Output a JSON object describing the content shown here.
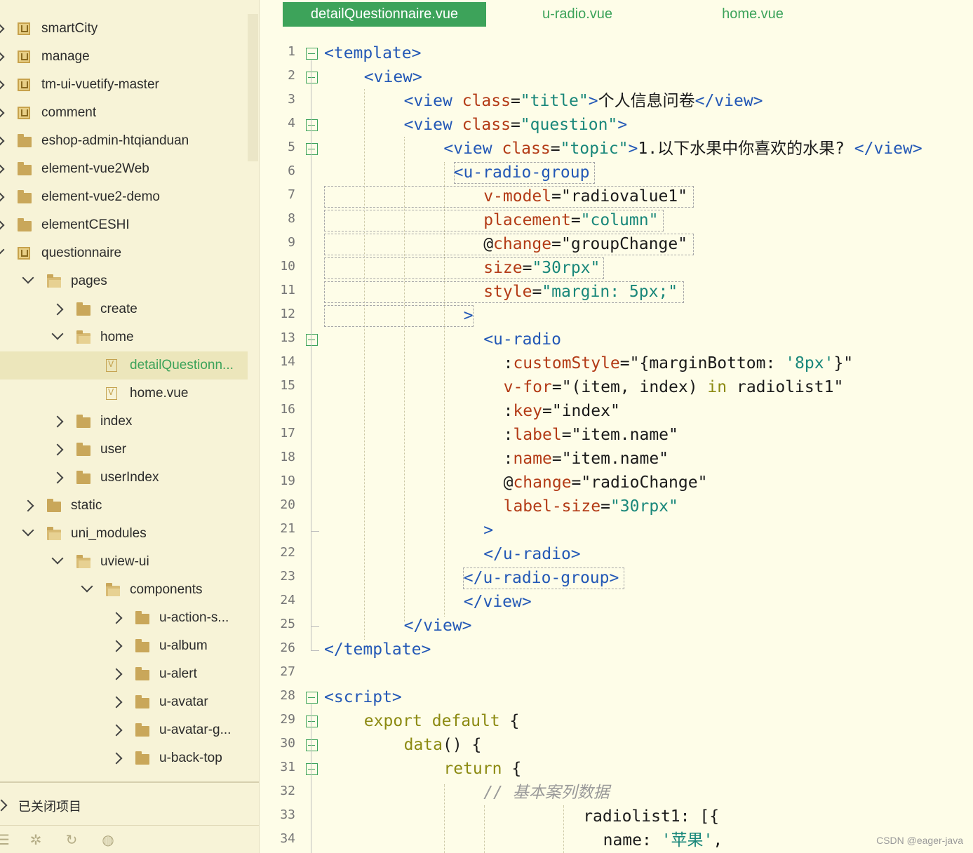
{
  "sidebar": {
    "tree": [
      {
        "label": "smartCity",
        "type": "project",
        "expanded": false,
        "depth": 0
      },
      {
        "label": "manage",
        "type": "project",
        "expanded": false,
        "depth": 0
      },
      {
        "label": "tm-ui-vuetify-master",
        "type": "project",
        "expanded": false,
        "depth": 0
      },
      {
        "label": "comment",
        "type": "project",
        "expanded": false,
        "depth": 0
      },
      {
        "label": "eshop-admin-htqianduan",
        "type": "folder-project",
        "expanded": false,
        "depth": 0
      },
      {
        "label": "element-vue2Web",
        "type": "folder-project",
        "expanded": false,
        "depth": 0
      },
      {
        "label": "element-vue2-demo",
        "type": "folder-project",
        "expanded": false,
        "depth": 0
      },
      {
        "label": "elementCESHI",
        "type": "folder-project",
        "expanded": false,
        "depth": 0
      },
      {
        "label": "questionnaire",
        "type": "project",
        "expanded": true,
        "depth": 0
      },
      {
        "label": "pages",
        "type": "folder",
        "expanded": true,
        "depth": 1
      },
      {
        "label": "create",
        "type": "folder",
        "expanded": false,
        "depth": 2
      },
      {
        "label": "home",
        "type": "folder",
        "expanded": true,
        "depth": 2
      },
      {
        "label": "detailQuestionn...",
        "type": "vue-file",
        "selected": true,
        "depth": 3
      },
      {
        "label": "home.vue",
        "type": "vue-file",
        "depth": 3
      },
      {
        "label": "index",
        "type": "folder",
        "expanded": false,
        "depth": 2
      },
      {
        "label": "user",
        "type": "folder",
        "expanded": false,
        "depth": 2
      },
      {
        "label": "userIndex",
        "type": "folder",
        "expanded": false,
        "depth": 2
      },
      {
        "label": "static",
        "type": "folder",
        "expanded": false,
        "depth": 1
      },
      {
        "label": "uni_modules",
        "type": "folder",
        "expanded": true,
        "depth": 1
      },
      {
        "label": "uview-ui",
        "type": "folder",
        "expanded": true,
        "depth": 2
      },
      {
        "label": "components",
        "type": "folder",
        "expanded": true,
        "depth": 3
      },
      {
        "label": "u-action-s...",
        "type": "folder",
        "expanded": false,
        "depth": 4
      },
      {
        "label": "u-album",
        "type": "folder",
        "expanded": false,
        "depth": 4
      },
      {
        "label": "u-alert",
        "type": "folder",
        "expanded": false,
        "depth": 4
      },
      {
        "label": "u-avatar",
        "type": "folder",
        "expanded": false,
        "depth": 4
      },
      {
        "label": "u-avatar-g...",
        "type": "folder",
        "expanded": false,
        "depth": 4
      },
      {
        "label": "u-back-top",
        "type": "folder",
        "expanded": false,
        "depth": 4
      }
    ],
    "closed_projects_label": "已关闭项目",
    "bottom_icons": [
      "list-icon",
      "bug-icon",
      "sync-icon",
      "globe-icon"
    ]
  },
  "tabs": [
    {
      "label": "detailQuestionnaire.vue",
      "active": true
    },
    {
      "label": "u-radio.vue",
      "active": false
    },
    {
      "label": "home.vue",
      "active": false
    }
  ],
  "code": [
    {
      "n": "1",
      "fold": "open",
      "tokens": [
        [
          "tag",
          "<template>"
        ]
      ]
    },
    {
      "n": "2",
      "fold": "open",
      "tokens": [
        [
          "tag",
          "<view>"
        ]
      ]
    },
    {
      "n": "3",
      "tokens": [
        [
          "tag",
          "<view "
        ],
        [
          "attr",
          "class"
        ],
        [
          "punc",
          "="
        ],
        [
          "str",
          "\"title\""
        ],
        [
          "tag",
          ">"
        ],
        [
          "plain",
          "个人信息问卷"
        ],
        [
          "tag",
          "</view>"
        ]
      ]
    },
    {
      "n": "4",
      "fold": "open",
      "tokens": [
        [
          "tag",
          "<view "
        ],
        [
          "attr",
          "class"
        ],
        [
          "punc",
          "="
        ],
        [
          "str",
          "\"question\""
        ],
        [
          "tag",
          ">"
        ]
      ]
    },
    {
      "n": "5",
      "fold": "open",
      "tokens": [
        [
          "tag",
          "<view "
        ],
        [
          "attr",
          "class"
        ],
        [
          "punc",
          "="
        ],
        [
          "str",
          "\"topic\""
        ],
        [
          "tag",
          ">"
        ],
        [
          "plain",
          "1.以下水果中你喜欢的水果? "
        ],
        [
          "tag",
          "</view>"
        ]
      ]
    },
    {
      "n": "6",
      "tokens": [
        [
          "tag",
          "<u-radio-group"
        ]
      ]
    },
    {
      "n": "7",
      "tokens": [
        [
          "attr",
          "v-model"
        ],
        [
          "punc",
          "="
        ],
        [
          "plain",
          "\"radiovalue1\""
        ]
      ]
    },
    {
      "n": "8",
      "tokens": [
        [
          "attr",
          "placement"
        ],
        [
          "punc",
          "="
        ],
        [
          "str",
          "\"column\""
        ]
      ]
    },
    {
      "n": "9",
      "tokens": [
        [
          "punc",
          "@"
        ],
        [
          "attr",
          "change"
        ],
        [
          "punc",
          "="
        ],
        [
          "plain",
          "\"groupChange\""
        ]
      ]
    },
    {
      "n": "10",
      "tokens": [
        [
          "attr",
          "size"
        ],
        [
          "punc",
          "="
        ],
        [
          "str",
          "\"30rpx\""
        ]
      ]
    },
    {
      "n": "11",
      "tokens": [
        [
          "attr",
          "style"
        ],
        [
          "punc",
          "="
        ],
        [
          "str",
          "\"margin: 5px;\""
        ]
      ]
    },
    {
      "n": "12",
      "tokens": [
        [
          "tag",
          ">"
        ]
      ]
    },
    {
      "n": "13",
      "fold": "open",
      "tokens": [
        [
          "tag",
          "<u-radio"
        ]
      ]
    },
    {
      "n": "14",
      "tokens": [
        [
          "punc",
          ":"
        ],
        [
          "attr",
          "customStyle"
        ],
        [
          "punc",
          "="
        ],
        [
          "plain",
          "\"{marginBottom: "
        ],
        [
          "str",
          "'8px'"
        ],
        [
          "plain",
          "}\""
        ]
      ]
    },
    {
      "n": "15",
      "tokens": [
        [
          "attr",
          "v-for"
        ],
        [
          "punc",
          "="
        ],
        [
          "plain",
          "\"(item, index) "
        ],
        [
          "kw",
          "in"
        ],
        [
          "plain",
          " radiolist1\""
        ]
      ]
    },
    {
      "n": "16",
      "tokens": [
        [
          "punc",
          ":"
        ],
        [
          "attr",
          "key"
        ],
        [
          "punc",
          "="
        ],
        [
          "plain",
          "\"index\""
        ]
      ]
    },
    {
      "n": "17",
      "tokens": [
        [
          "punc",
          ":"
        ],
        [
          "attr",
          "label"
        ],
        [
          "punc",
          "="
        ],
        [
          "plain",
          "\"item.name\""
        ]
      ]
    },
    {
      "n": "18",
      "tokens": [
        [
          "punc",
          ":"
        ],
        [
          "attr",
          "name"
        ],
        [
          "punc",
          "="
        ],
        [
          "plain",
          "\"item.name\""
        ]
      ]
    },
    {
      "n": "19",
      "tokens": [
        [
          "punc",
          "@"
        ],
        [
          "attr",
          "change"
        ],
        [
          "punc",
          "="
        ],
        [
          "plain",
          "\"radioChange\""
        ]
      ]
    },
    {
      "n": "20",
      "tokens": [
        [
          "attr",
          "label-size"
        ],
        [
          "punc",
          "="
        ],
        [
          "str",
          "\"30rpx\""
        ]
      ]
    },
    {
      "n": "21",
      "tokens": [
        [
          "tag",
          ">"
        ]
      ]
    },
    {
      "n": "22",
      "tokens": [
        [
          "tag",
          "</u-radio>"
        ]
      ]
    },
    {
      "n": "23",
      "tokens": [
        [
          "tag",
          "</u-radio-group>"
        ]
      ]
    },
    {
      "n": "24",
      "tokens": [
        [
          "tag",
          "</view>"
        ]
      ]
    },
    {
      "n": "25",
      "tokens": [
        [
          "tag",
          "</view>"
        ]
      ]
    },
    {
      "n": "26",
      "tokens": [
        [
          "tag",
          "</template>"
        ]
      ]
    },
    {
      "n": "27",
      "tokens": []
    },
    {
      "n": "28",
      "fold": "open",
      "tokens": [
        [
          "tag",
          "<script>"
        ]
      ]
    },
    {
      "n": "29",
      "fold": "open",
      "tokens": [
        [
          "kw",
          "export default"
        ],
        [
          "plain",
          " {"
        ]
      ]
    },
    {
      "n": "30",
      "fold": "open",
      "tokens": [
        [
          "kw",
          "data"
        ],
        [
          "plain",
          "() {"
        ]
      ]
    },
    {
      "n": "31",
      "fold": "open",
      "tokens": [
        [
          "kw",
          "return"
        ],
        [
          "plain",
          " {"
        ]
      ]
    },
    {
      "n": "32",
      "tokens": [
        [
          "cm",
          "// 基本案列数据"
        ]
      ]
    },
    {
      "n": "33",
      "tokens": [
        [
          "plain",
          "radiolist1: [{"
        ]
      ]
    },
    {
      "n": "34",
      "tokens": [
        [
          "plain",
          "name: "
        ],
        [
          "str",
          "'苹果'"
        ],
        [
          "plain",
          ","
        ]
      ]
    }
  ],
  "watermark": "CSDN @eager-java",
  "colors": {
    "accent": "#3da35a",
    "tag": "#2358b6",
    "attr": "#b33b16",
    "string": "#19877a",
    "keyword": "#8c8a12",
    "editor_bg": "#fefde8",
    "sidebar_bg": "#f7f3d7"
  }
}
